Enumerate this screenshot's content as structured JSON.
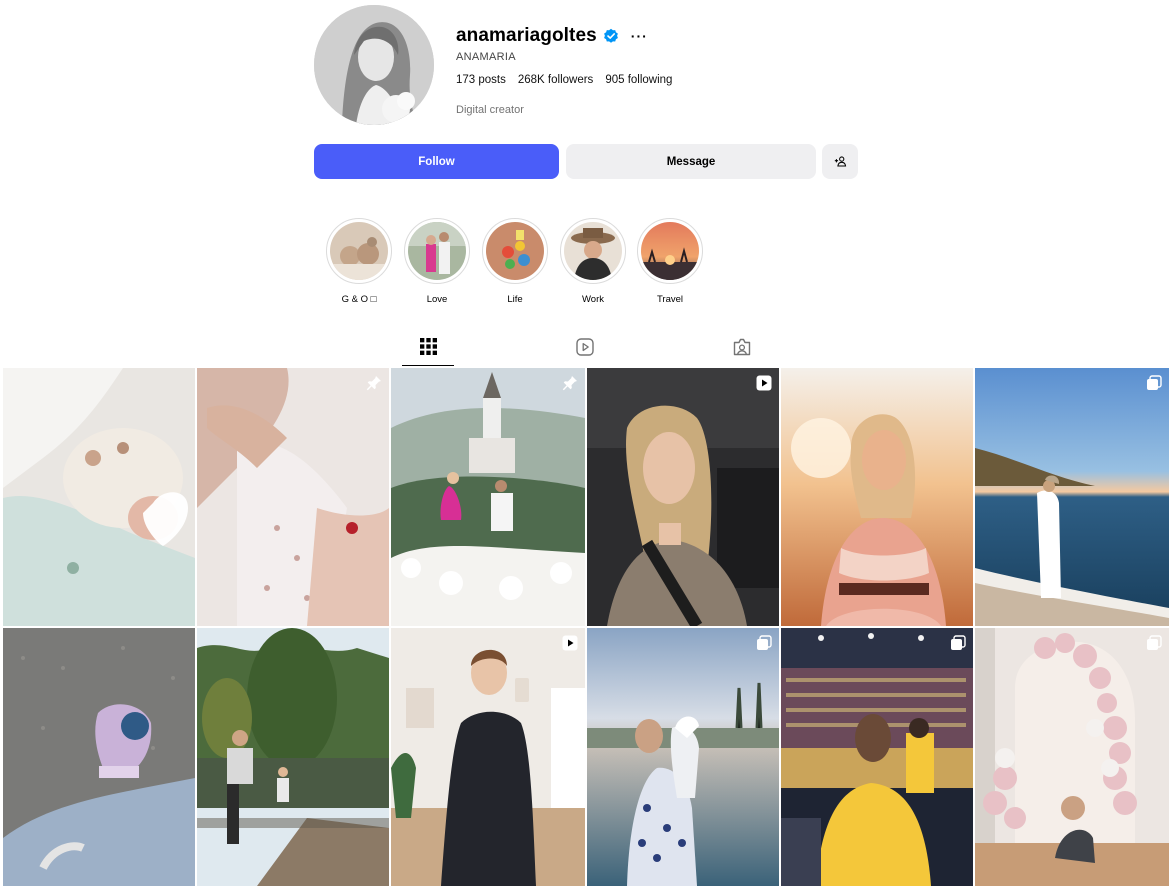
{
  "profile": {
    "username": "anamariagoltes",
    "verified": true,
    "full_name": "ANAMARIA",
    "stats": {
      "posts_count": "173",
      "posts_label": " posts",
      "followers_count": "268K",
      "followers_label": " followers",
      "following_count": "905",
      "following_label": " following"
    },
    "category": "Digital creator"
  },
  "actions": {
    "follow_label": "Follow",
    "message_label": "Message"
  },
  "highlights": [
    {
      "label": "G & O □",
      "icon": "highlight-family"
    },
    {
      "label": "Love",
      "icon": "highlight-couple"
    },
    {
      "label": "Life",
      "icon": "highlight-toys"
    },
    {
      "label": "Work",
      "icon": "highlight-hat"
    },
    {
      "label": "Travel",
      "icon": "highlight-sunset"
    }
  ],
  "tabs": [
    {
      "id": "posts",
      "icon": "grid-icon",
      "active": true
    },
    {
      "id": "reels",
      "icon": "reels-icon",
      "active": false
    },
    {
      "id": "tagged",
      "icon": "tagged-icon",
      "active": false
    }
  ],
  "posts": [
    {
      "subject": "newborn in blanket",
      "badge": "none"
    },
    {
      "subject": "holding baby feet",
      "badge": "pinned-icon"
    },
    {
      "subject": "proposal by lake church",
      "badge": "pinned-icon"
    },
    {
      "subject": "selfie in car",
      "badge": "reel-icon"
    },
    {
      "subject": "portrait at sunset",
      "badge": "none"
    },
    {
      "subject": "woman on boat at sunset",
      "badge": "carousel-icon"
    },
    {
      "subject": "baby on gravel",
      "badge": "none"
    },
    {
      "subject": "park with lake",
      "badge": "none"
    },
    {
      "subject": "mirror selfie",
      "badge": "reel-icon"
    },
    {
      "subject": "mother and baby at pool",
      "badge": "carousel-icon"
    },
    {
      "subject": "basketball game",
      "badge": "carousel-icon"
    },
    {
      "subject": "balloon arch and baby",
      "badge": "carousel-icon"
    }
  ],
  "colors": {
    "accent": "#4a5df9",
    "secondary_button": "#efeff1",
    "verified": "#0095f6",
    "muted_text": "#737373"
  }
}
